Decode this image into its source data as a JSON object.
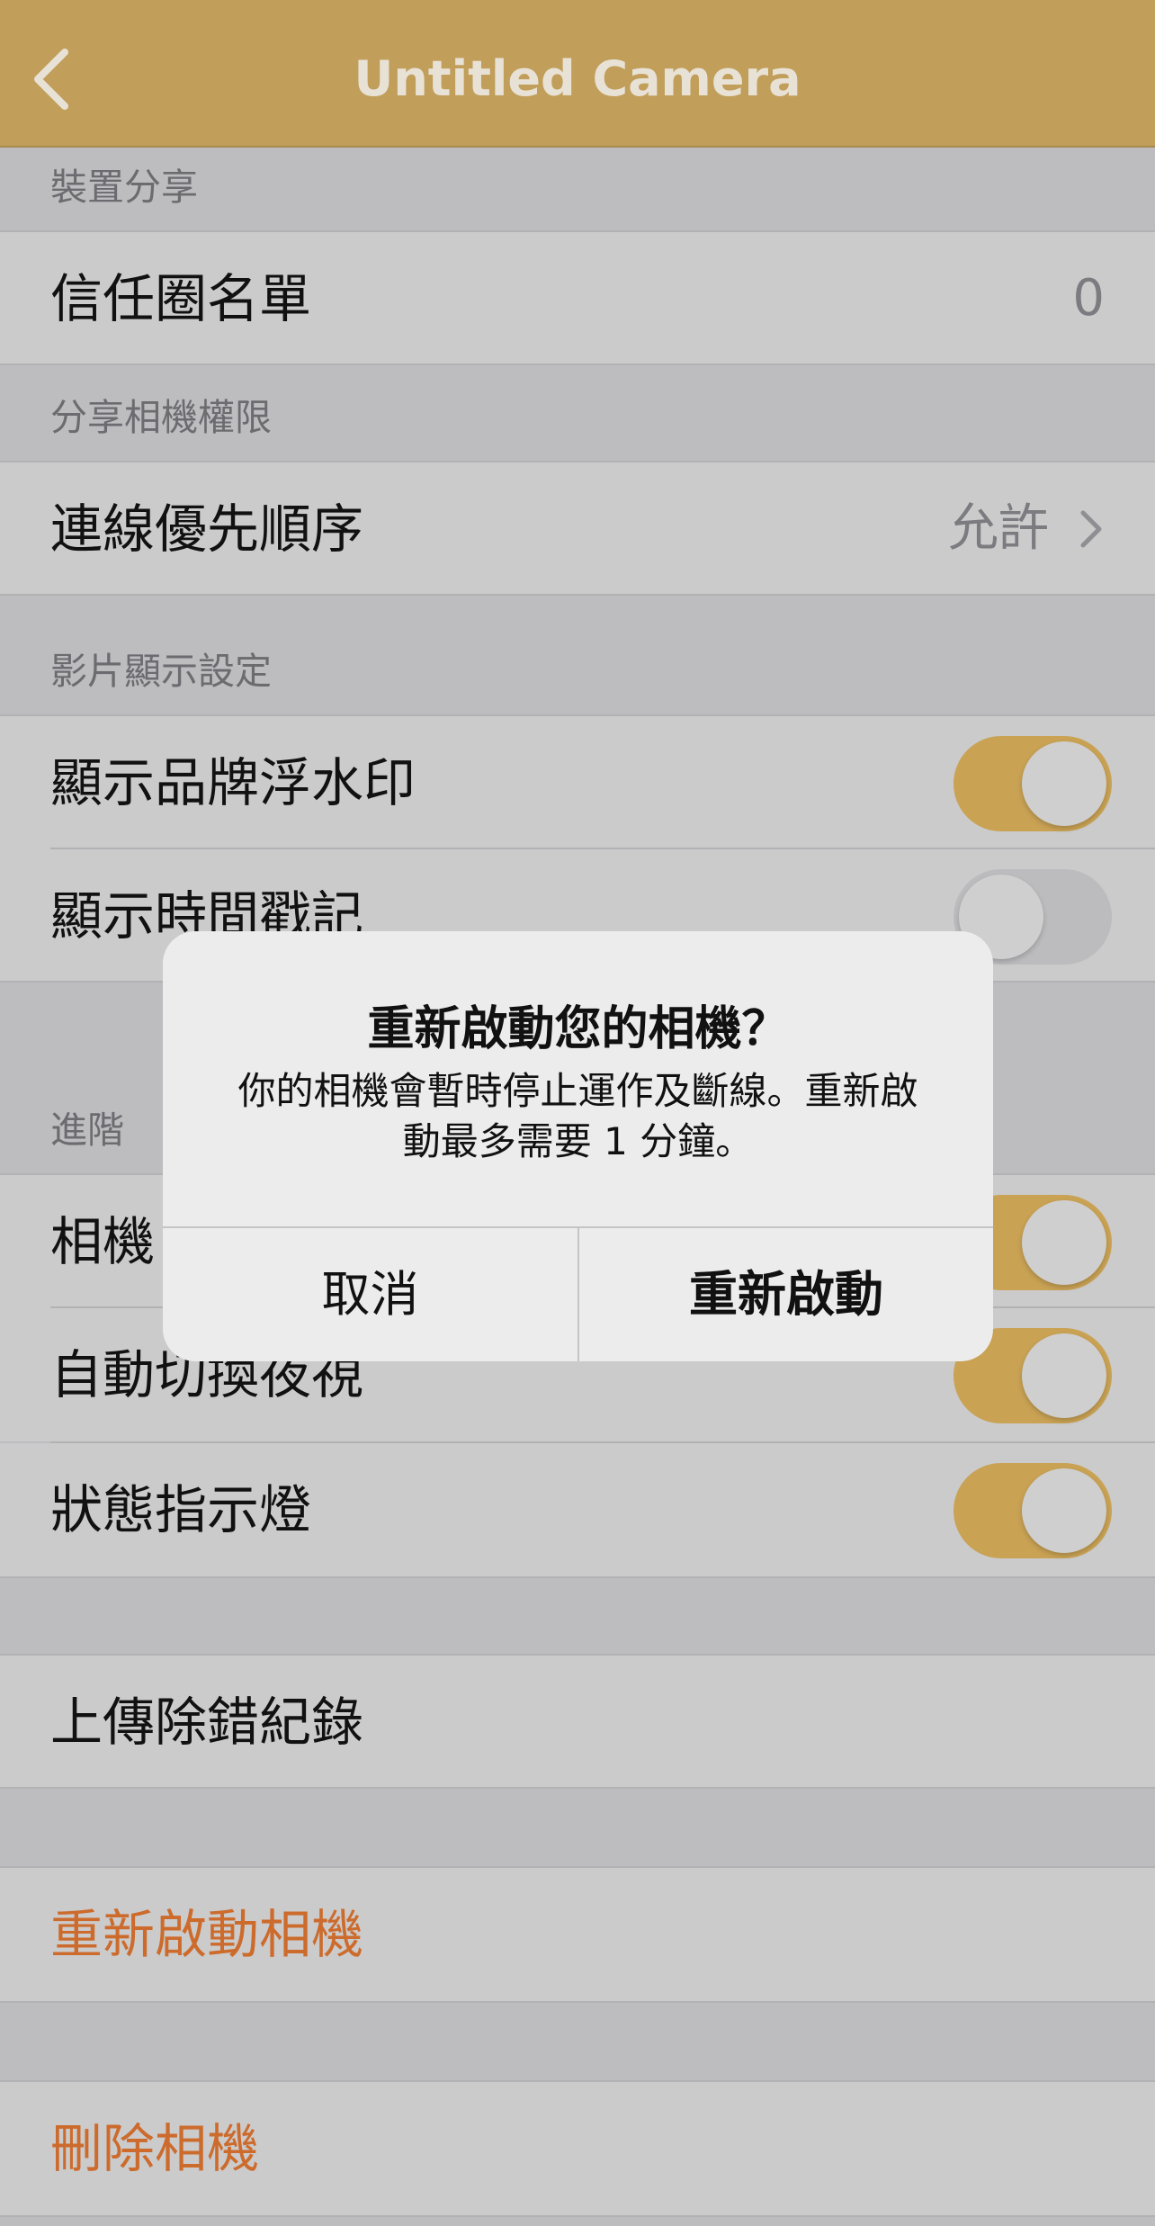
{
  "nav": {
    "title": "Untitled Camera",
    "back_icon": "chevron-left-icon"
  },
  "sections": {
    "device_sharing": "裝置分享",
    "share_permissions": "分享相機權限",
    "video_display": "影片顯示設定",
    "advanced": "進階"
  },
  "rows": {
    "trust_circle": {
      "label": "信任圈名單",
      "value": "0"
    },
    "connection_priority": {
      "label": "連線優先順序",
      "value": "允許"
    },
    "brand_watermark": {
      "label": "顯示品牌浮水印",
      "on": true
    },
    "timestamp": {
      "label": "顯示時間戳記",
      "on": false
    },
    "camera_row": {
      "label": "相機",
      "on": true
    },
    "auto_night": {
      "label": "自動切換夜視",
      "on": true
    },
    "status_light": {
      "label": "狀態指示燈",
      "on": true
    },
    "upload_logs": {
      "label": "上傳除錯紀錄"
    },
    "restart_camera": {
      "label": "重新啟動相機"
    },
    "delete_camera": {
      "label": "刪除相機"
    }
  },
  "alert": {
    "title": "重新啟動您的相機？",
    "message": "你的相機會暫時停止運作及斷線。重新啟動最多需要 1 分鐘。",
    "cancel_label": "取消",
    "confirm_label": "重新啟動"
  },
  "colors": {
    "accent": "#c19e5a",
    "toggle_on": "#c9a254",
    "destructive": "#cc6b2c"
  }
}
